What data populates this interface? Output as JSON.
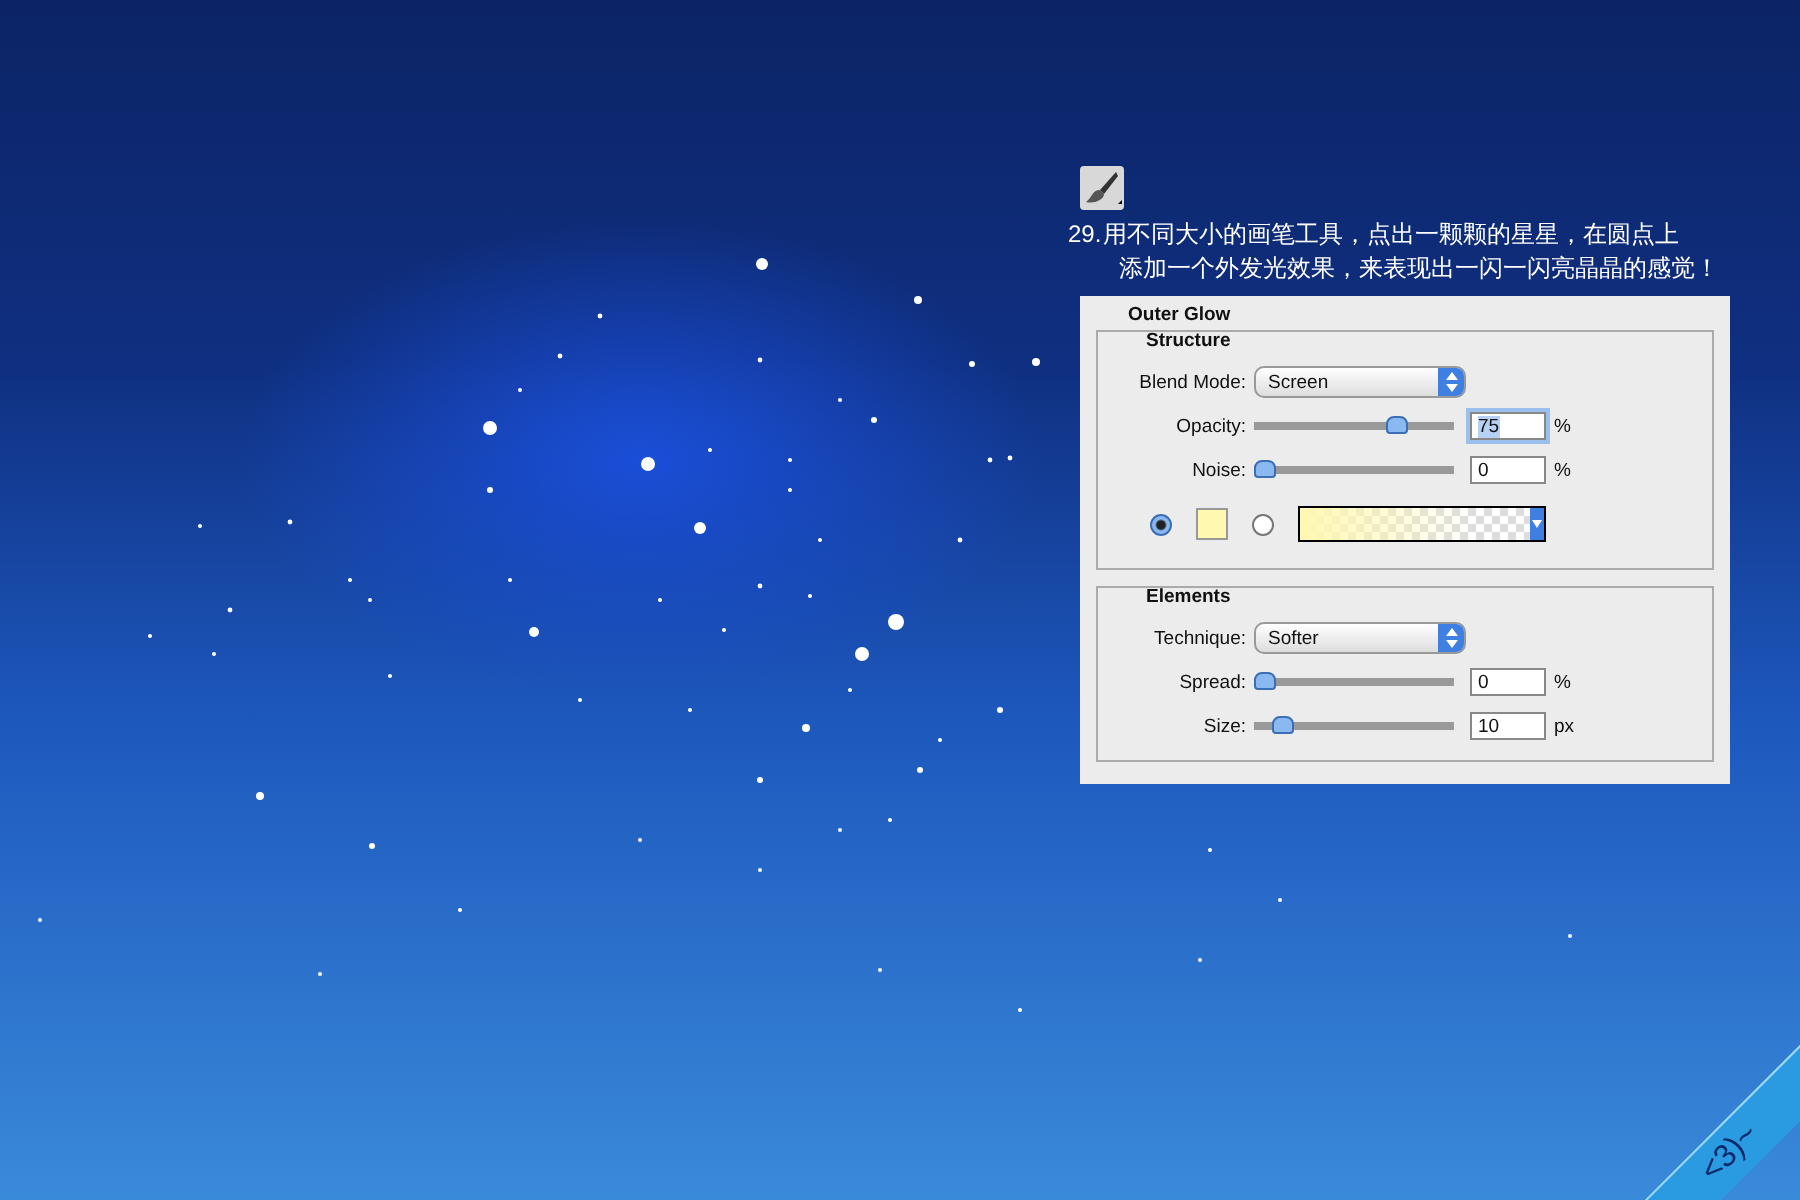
{
  "instruction": {
    "number": "29.",
    "lines": [
      "用不同大小的画笔工具，点出一颗颗的星星，在圆点上",
      "添加一个外发光效果，来表现出一闪一闪亮晶晶的感觉！"
    ]
  },
  "panel": {
    "title": "Outer Glow",
    "groups": [
      {
        "title": "Structure",
        "rows": [
          {
            "kind": "select",
            "label": "Blend Mode:",
            "value": "Screen"
          },
          {
            "kind": "slider",
            "label": "Opacity:",
            "level": 0.75,
            "value": "75",
            "unit": "%",
            "focused": true
          },
          {
            "kind": "slider",
            "label": "Noise:",
            "level": 0,
            "value": "0",
            "unit": "%",
            "focused": false
          },
          {
            "kind": "fill",
            "options": [
              {
                "kind": "color",
                "selected": true,
                "color": "#fff8b0"
              },
              {
                "kind": "gradient",
                "selected": false,
                "color": "#fff8b0"
              }
            ]
          }
        ]
      },
      {
        "title": "Elements",
        "rows": [
          {
            "kind": "select",
            "label": "Technique:",
            "value": "Softer"
          },
          {
            "kind": "slider",
            "label": "Spread:",
            "level": 0,
            "value": "0",
            "unit": "%",
            "focused": false
          },
          {
            "kind": "slider",
            "label": "Size:",
            "level": 0.1,
            "value": "10",
            "unit": "px",
            "focused": false
          }
        ]
      }
    ]
  },
  "corner_tab": {
    "text": "<3)~"
  }
}
